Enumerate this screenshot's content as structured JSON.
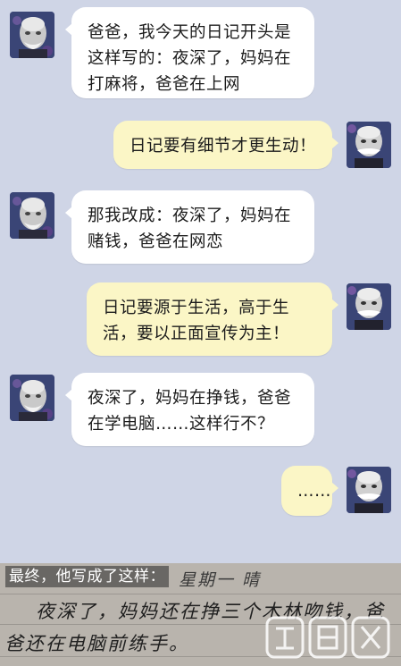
{
  "messages": [
    {
      "side": "left",
      "lines": [
        "爸爸，我今天的日记开头是",
        "这样写的：夜深了，妈妈在",
        "打麻将，爸爸在上网"
      ]
    },
    {
      "side": "right",
      "lines": [
        "日记要有细节才更生动！"
      ]
    },
    {
      "side": "left",
      "lines": [
        "那我改成：夜深了，妈妈在",
        "赌钱，爸爸在网恋"
      ]
    },
    {
      "side": "right",
      "lines": [
        "日记要源于生活，高于生",
        "活，要以正面宣传为主！"
      ]
    },
    {
      "side": "left",
      "lines": [
        "夜深了，妈妈在挣钱，爸爸",
        "在学电脑……这样行不？"
      ]
    },
    {
      "side": "right",
      "lines": [
        "……"
      ]
    }
  ],
  "photo": {
    "caption": "最终，他写成了这样：",
    "diary_header": "星期一  晴",
    "diary_line1": "夜深了，妈妈还在挣三个木林吻钱，爸",
    "diary_line2": "爸还在电脑前练手。"
  },
  "colors": {
    "background": "#cfd5e6",
    "bubble_left": "#ffffff",
    "bubble_right": "#fbf6c6"
  }
}
